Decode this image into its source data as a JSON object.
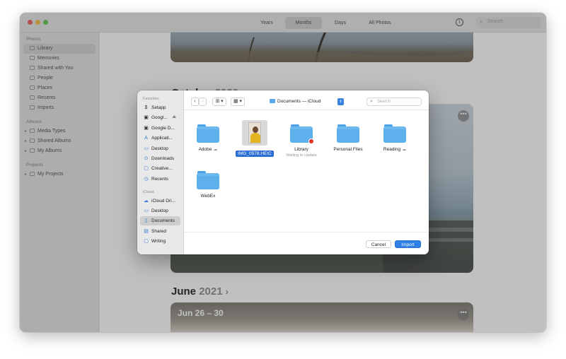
{
  "toolbar": {
    "segments": [
      {
        "label": "Years",
        "active": false
      },
      {
        "label": "Months",
        "active": true
      },
      {
        "label": "Days",
        "active": false
      },
      {
        "label": "All Photos",
        "active": false
      }
    ],
    "search_placeholder": "Search"
  },
  "sidebar": {
    "sections": [
      {
        "title": "Photos",
        "items": [
          "Library",
          "Memories",
          "Shared with You",
          "People",
          "Places",
          "Recents",
          "Imports"
        ]
      },
      {
        "title": "Albums",
        "items": [
          "Media Types",
          "Shared Albums",
          "My Albums"
        ]
      },
      {
        "title": "Projects",
        "items": [
          "My Projects"
        ]
      }
    ],
    "selected": "Library"
  },
  "content": {
    "sections": [
      {
        "month": "October",
        "year": "2020"
      },
      {
        "month": "June",
        "year": "2021"
      }
    ],
    "date_range_label": "Jun 26 – 30"
  },
  "dialog": {
    "favorites_title": "Favorites",
    "favorites": [
      {
        "label": "Setapp",
        "icon": "setapp-icon"
      },
      {
        "label": "Googl...",
        "icon": "drive-icon",
        "eject": true
      },
      {
        "label": "Google D...",
        "icon": "drive-icon"
      },
      {
        "label": "Applicati...",
        "icon": "applications-icon"
      },
      {
        "label": "Desktop",
        "icon": "desktop-icon"
      },
      {
        "label": "Downloads",
        "icon": "downloads-icon"
      },
      {
        "label": "Creative...",
        "icon": "folder-icon"
      },
      {
        "label": "Recents",
        "icon": "recents-icon"
      }
    ],
    "icloud_title": "iCloud",
    "icloud": [
      {
        "label": "iCloud Dri...",
        "icon": "cloud-icon"
      },
      {
        "label": "Desktop",
        "icon": "desktop-icon"
      },
      {
        "label": "Documents",
        "icon": "document-icon",
        "selected": true
      },
      {
        "label": "Shared",
        "icon": "shared-folder-icon"
      },
      {
        "label": "Writing",
        "icon": "folder-icon"
      }
    ],
    "location": "Documents — iCloud",
    "search_placeholder": "Search",
    "items": [
      {
        "label": "Adobe",
        "kind": "folder",
        "cloud": true
      },
      {
        "label": "IMG_0578.HEIC",
        "kind": "image",
        "selected": true
      },
      {
        "label": "Library",
        "kind": "folder",
        "sub": "Waiting to Update",
        "badge": true
      },
      {
        "label": "Personal Files",
        "kind": "folder"
      },
      {
        "label": "Reading",
        "kind": "folder",
        "cloud": true
      },
      {
        "label": "WebEx",
        "kind": "folder"
      }
    ],
    "cancel_label": "Cancel",
    "import_label": "Import"
  },
  "icon_glyphs": {
    "setapp-icon": "$",
    "drive-icon": "▣",
    "applications-icon": "A",
    "desktop-icon": "▭",
    "downloads-icon": "⊙",
    "folder-icon": "▢",
    "recents-icon": "◷",
    "cloud-icon": "☁",
    "document-icon": "▯",
    "shared-folder-icon": "▤"
  },
  "colors": {
    "accent": "#2e7fe6",
    "selection": "#2b6fd6",
    "folder": "#5eb0ec",
    "close": "#ee5b54",
    "minimize": "#f6be3c",
    "zoom": "#5fc84f"
  }
}
